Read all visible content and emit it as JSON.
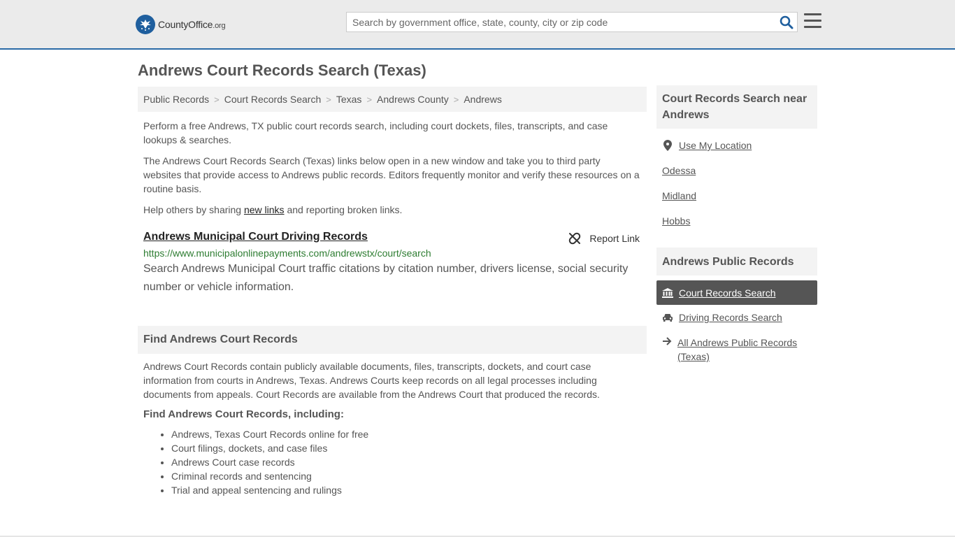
{
  "header": {
    "logo_text_main": "CountyOffice",
    "logo_text_tld": ".org",
    "search_placeholder": "Search by government office, state, county, city or zip code"
  },
  "page_title": "Andrews Court Records Search (Texas)",
  "breadcrumb": [
    "Public Records",
    "Court Records Search",
    "Texas",
    "Andrews County",
    "Andrews"
  ],
  "intro": {
    "p1": "Perform a free Andrews, TX public court records search, including court dockets, files, transcripts, and case lookups & searches.",
    "p2": "The Andrews Court Records Search (Texas) links below open in a new window and take you to third party websites that provide access to Andrews public records. Editors frequently monitor and verify these resources on a routine basis.",
    "p3_before": "Help others by sharing ",
    "p3_link": "new links",
    "p3_after": " and reporting broken links."
  },
  "result": {
    "title": "Andrews Municipal Court Driving Records",
    "report_label": "Report Link",
    "url": "https://www.municipalonlinepayments.com/andrewstx/court/search",
    "description": "Search Andrews Municipal Court traffic citations by citation number, drivers license, social security number or vehicle information."
  },
  "find_section": {
    "heading": "Find Andrews Court Records",
    "paragraph": "Andrews Court Records contain publicly available documents, files, transcripts, dockets, and court case information from courts in Andrews, Texas. Andrews Courts keep records on all legal processes including documents from appeals. Court Records are available from the Andrews Court that produced the records.",
    "subheading": "Find Andrews Court Records, including:",
    "items": [
      "Andrews, Texas Court Records online for free",
      "Court filings, dockets, and case files",
      "Andrews Court case records",
      "Criminal records and sentencing",
      "Trial and appeal sentencing and rulings"
    ]
  },
  "sidebar": {
    "nearby_heading": "Court Records Search near Andrews",
    "use_location": "Use My Location",
    "nearby": [
      "Odessa",
      "Midland",
      "Hobbs"
    ],
    "public_heading": "Andrews Public Records",
    "links": {
      "court": "Court Records Search",
      "driving": "Driving Records Search",
      "all": "All Andrews Public Records (Texas)"
    }
  },
  "colors": {
    "brand_blue": "#1f5f9e",
    "url_green": "#2e7d32",
    "active_bg": "#555555"
  }
}
